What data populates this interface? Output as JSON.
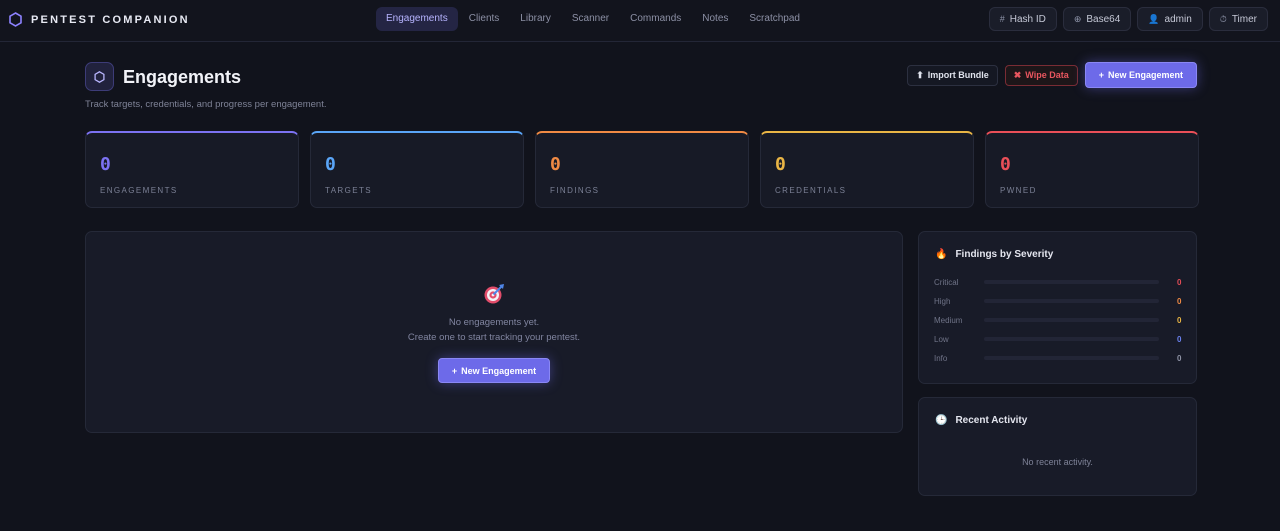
{
  "app": {
    "brand": "PENTEST COMPANION",
    "brand_icon": "hexagon-icon"
  },
  "nav": {
    "items": [
      {
        "label": "Engagements",
        "active": true
      },
      {
        "label": "Clients"
      },
      {
        "label": "Library"
      },
      {
        "label": "Scanner"
      },
      {
        "label": "Commands"
      },
      {
        "label": "Notes"
      },
      {
        "label": "Scratchpad"
      }
    ]
  },
  "tools": {
    "hash_id": {
      "icon": "#",
      "label": "Hash ID"
    },
    "base64": {
      "icon": "⊕",
      "label": "Base64"
    },
    "user": {
      "icon": "👤",
      "label": "admin"
    },
    "timer": {
      "icon": "⏱",
      "label": "Timer"
    }
  },
  "page": {
    "title": "Engagements",
    "subtitle": "Track targets, credentials, and progress per engagement.",
    "actions": {
      "import_icon": "⬆",
      "import": "Import Bundle",
      "wipe_icon": "✖",
      "wipe": "Wipe Data",
      "new_icon": "+",
      "new": "New Engagement"
    }
  },
  "stats": [
    {
      "value": "0",
      "label": "ENGAGEMENTS",
      "color": "#7c72f2"
    },
    {
      "value": "0",
      "label": "TARGETS",
      "color": "#5aa5f7"
    },
    {
      "value": "0",
      "label": "FINDINGS",
      "color": "#f08a44"
    },
    {
      "value": "0",
      "label": "CREDENTIALS",
      "color": "#e9b545"
    },
    {
      "value": "0",
      "label": "PWNED",
      "color": "#ea4f58"
    }
  ],
  "empty": {
    "line1": "No engagements yet.",
    "line2": "Create one to start tracking your pentest.",
    "button_icon": "+",
    "button": "New Engagement"
  },
  "severity": {
    "icon": "🔥",
    "title": "Findings by Severity",
    "rows": [
      {
        "label": "Critical",
        "count": "0",
        "level": 0,
        "color": "#e34c57"
      },
      {
        "label": "High",
        "count": "0",
        "level": 0,
        "color": "#f08a44"
      },
      {
        "label": "Medium",
        "count": "0",
        "level": 0,
        "color": "#e9b545"
      },
      {
        "label": "Low",
        "count": "0",
        "level": 0,
        "color": "#6b82f0"
      },
      {
        "label": "Info",
        "count": "0",
        "level": 0,
        "color": "#8f93a6"
      }
    ]
  },
  "activity": {
    "icon": "🕒",
    "title": "Recent Activity",
    "empty": "No recent activity."
  }
}
